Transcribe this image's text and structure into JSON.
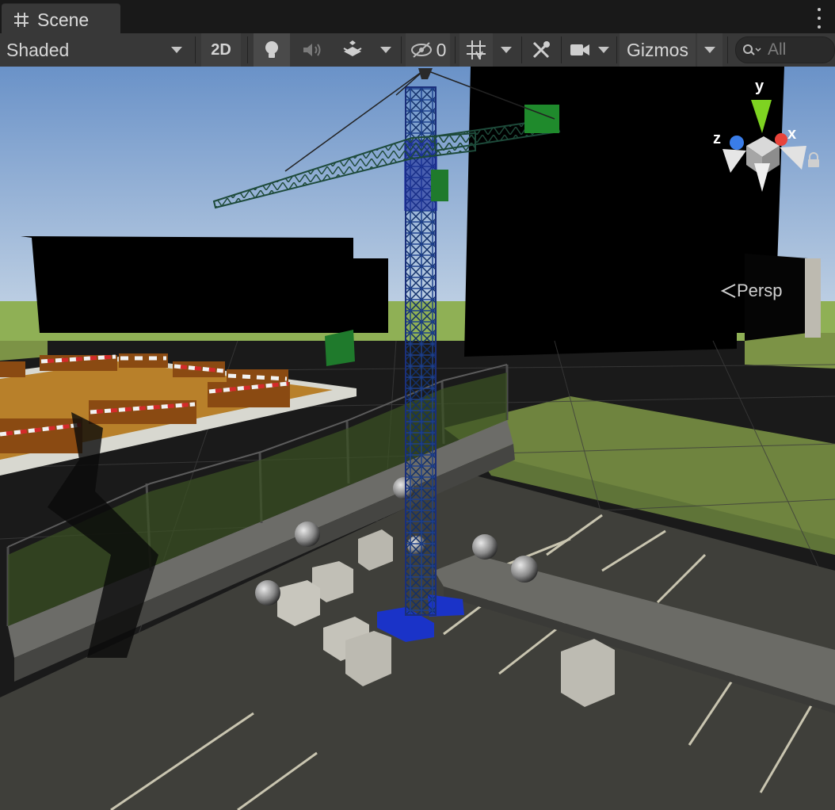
{
  "tab": {
    "label": "Scene",
    "icon": "grid-hash-icon"
  },
  "toolbar": {
    "draw_mode": "Shaded",
    "mode_2d": "2D",
    "hidden_count": "0",
    "gizmos_label": "Gizmos",
    "search_placeholder": "All"
  },
  "orientation_gizmo": {
    "x_label": "x",
    "y_label": "y",
    "z_label": "z",
    "projection": "Persp"
  },
  "colors": {
    "x_axis": "#e8433a",
    "y_axis": "#7ed321",
    "z_axis": "#3a7de8",
    "toolbar_bg": "#383838",
    "sky_top": "#6a92c8",
    "sky_bottom": "#bcd0e6"
  }
}
